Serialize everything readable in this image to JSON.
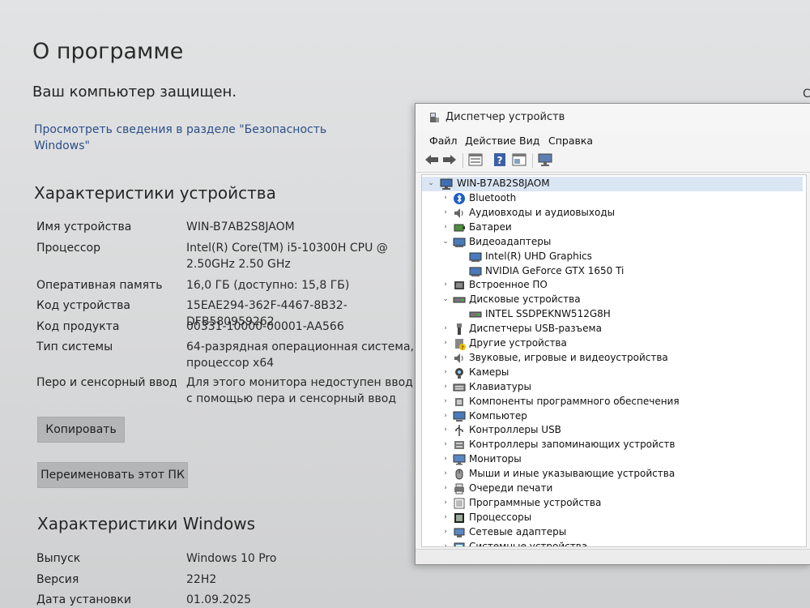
{
  "settings": {
    "title": "О программе",
    "protected": "Ваш компьютер защищен.",
    "security_link": "Просмотреть сведения в разделе \"Безопасность Windows\"",
    "edge_char": "С",
    "device_specs": {
      "heading": "Характеристики устройства",
      "rows": [
        {
          "label": "Имя устройства",
          "value": "WIN-B7AB2S8JAOM"
        },
        {
          "label": "Процессор",
          "value": "Intel(R) Core(TM) i5-10300H CPU @ 2.50GHz   2.50 GHz"
        },
        {
          "label": "Оперативная память",
          "value": "16,0 ГБ (доступно: 15,8 ГБ)"
        },
        {
          "label": "Код устройства",
          "value": "15EAE294-362F-4467-8B32-DFB580959262"
        },
        {
          "label": "Код продукта",
          "value": "00331-10000-00001-AA566"
        },
        {
          "label": "Тип системы",
          "value": "64-разрядная операционная система, процессор x64"
        },
        {
          "label": "Перо и сенсорный ввод",
          "value": "Для этого монитора недоступен ввод с помощью пера и сенсорный ввод"
        }
      ]
    },
    "copy_button": "Копировать",
    "rename_button": "Переименовать этот ПК",
    "windows_specs": {
      "heading": "Характеристики Windows",
      "rows": [
        {
          "label": "Выпуск",
          "value": "Windows 10 Pro"
        },
        {
          "label": "Версия",
          "value": "22H2"
        },
        {
          "label": "Дата установки",
          "value": "01.09.2025"
        }
      ]
    }
  },
  "device_manager": {
    "title": "Диспетчер устройств",
    "menu": [
      "Файл",
      "Действие",
      "Вид",
      "Справка"
    ],
    "toolbar_icons": [
      "back-arrow-icon",
      "forward-arrow-icon",
      "properties-icon",
      "help-icon",
      "view-icon",
      "monitor-scan-icon"
    ],
    "root": "WIN-B7AB2S8JAOM",
    "tree": [
      {
        "label": "Bluetooth",
        "icon": "bluetooth-icon",
        "level": 1,
        "expanded": false
      },
      {
        "label": "Аудиовходы и аудиовыходы",
        "icon": "speaker-icon",
        "level": 1,
        "expanded": false
      },
      {
        "label": "Батареи",
        "icon": "battery-icon",
        "level": 1,
        "expanded": false
      },
      {
        "label": "Видеоадаптеры",
        "icon": "display-adapter-icon",
        "level": 1,
        "expanded": true
      },
      {
        "label": "Intel(R) UHD Graphics",
        "icon": "display-adapter-icon",
        "level": 2
      },
      {
        "label": "NVIDIA GeForce GTX 1650 Ti",
        "icon": "display-adapter-icon",
        "level": 2
      },
      {
        "label": "Встроенное ПО",
        "icon": "firmware-icon",
        "level": 1,
        "expanded": false
      },
      {
        "label": "Дисковые устройства",
        "icon": "disk-drive-icon",
        "level": 1,
        "expanded": true
      },
      {
        "label": "INTEL SSDPEKNW512G8H",
        "icon": "disk-drive-icon",
        "level": 2
      },
      {
        "label": "Диспетчеры USB-разъема",
        "icon": "usb-connector-icon",
        "level": 1,
        "expanded": false
      },
      {
        "label": "Другие устройства",
        "icon": "unknown-device-icon",
        "level": 1,
        "expanded": false
      },
      {
        "label": "Звуковые, игровые и видеоустройства",
        "icon": "speaker-icon",
        "level": 1,
        "expanded": false
      },
      {
        "label": "Камеры",
        "icon": "camera-icon",
        "level": 1,
        "expanded": false
      },
      {
        "label": "Клавиатуры",
        "icon": "keyboard-icon",
        "level": 1,
        "expanded": false
      },
      {
        "label": "Компоненты программного обеспечения",
        "icon": "software-component-icon",
        "level": 1,
        "expanded": false
      },
      {
        "label": "Компьютер",
        "icon": "computer-icon",
        "level": 1,
        "expanded": false
      },
      {
        "label": "Контроллеры USB",
        "icon": "usb-icon",
        "level": 1,
        "expanded": false
      },
      {
        "label": "Контроллеры запоминающих устройств",
        "icon": "storage-controller-icon",
        "level": 1,
        "expanded": false
      },
      {
        "label": "Мониторы",
        "icon": "monitor-icon",
        "level": 1,
        "expanded": false
      },
      {
        "label": "Мыши и иные указывающие устройства",
        "icon": "mouse-icon",
        "level": 1,
        "expanded": false
      },
      {
        "label": "Очереди печати",
        "icon": "printer-icon",
        "level": 1,
        "expanded": false
      },
      {
        "label": "Программные устройства",
        "icon": "software-device-icon",
        "level": 1,
        "expanded": false
      },
      {
        "label": "Процессоры",
        "icon": "processor-icon",
        "level": 1,
        "expanded": false
      },
      {
        "label": "Сетевые адаптеры",
        "icon": "network-adapter-icon",
        "level": 1,
        "expanded": false
      },
      {
        "label": "Системные устройства",
        "icon": "system-device-icon",
        "level": 1,
        "expanded": false
      }
    ]
  }
}
